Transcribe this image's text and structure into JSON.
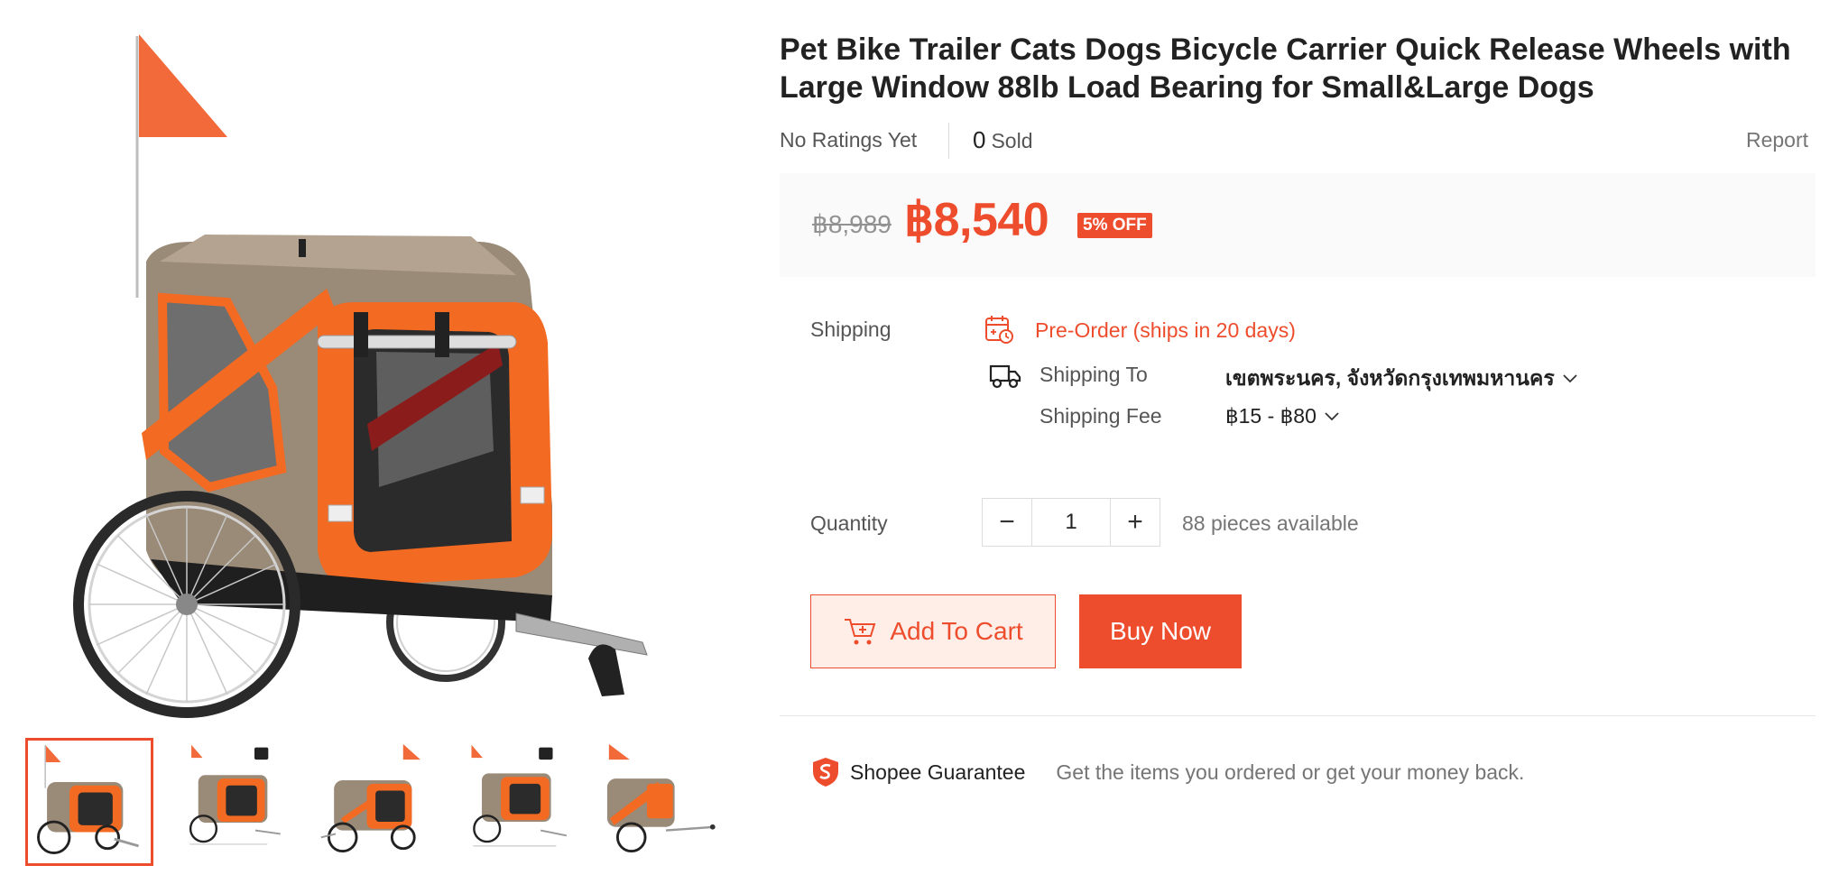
{
  "product": {
    "title": "Pet Bike Trailer Cats Dogs Bicycle Carrier Quick Release Wheels with Large Window 88lb Load Bearing for Small&Large Dogs",
    "ratings_text": "No Ratings Yet",
    "sold_count": "0",
    "sold_label": "Sold",
    "report_label": "Report"
  },
  "price": {
    "original": "฿8,989",
    "current": "฿8,540",
    "discount_badge": "5% OFF"
  },
  "shipping": {
    "label": "Shipping",
    "preorder_text": "Pre-Order (ships in 20 days)",
    "ship_to_label": "Shipping To",
    "ship_to_value": "เขตพระนคร, จังหวัดกรุงเทพมหานคร",
    "fee_label": "Shipping Fee",
    "fee_value": "฿15 - ฿80"
  },
  "quantity": {
    "label": "Quantity",
    "value": "1",
    "minus": "−",
    "plus": "+",
    "available_text": "88 pieces available"
  },
  "actions": {
    "add_to_cart": "Add To Cart",
    "buy_now": "Buy Now"
  },
  "guarantee": {
    "title": "Shopee Guarantee",
    "description": "Get the items you ordered or get your money back."
  },
  "gallery": {
    "thumbnail_count": 5,
    "active_index": 0
  },
  "colors": {
    "accent": "#ee4d2d",
    "accent_light": "#ffeee8",
    "price_bg": "#fafafa",
    "trailer_orange": "#f36a22",
    "trailer_tan": "#9a8a78"
  },
  "icons": {
    "preorder": "calendar-clock-icon",
    "shipping": "truck-icon",
    "cart": "cart-plus-icon",
    "guarantee": "shopee-shield-icon",
    "dropdown": "chevron-down-icon"
  }
}
